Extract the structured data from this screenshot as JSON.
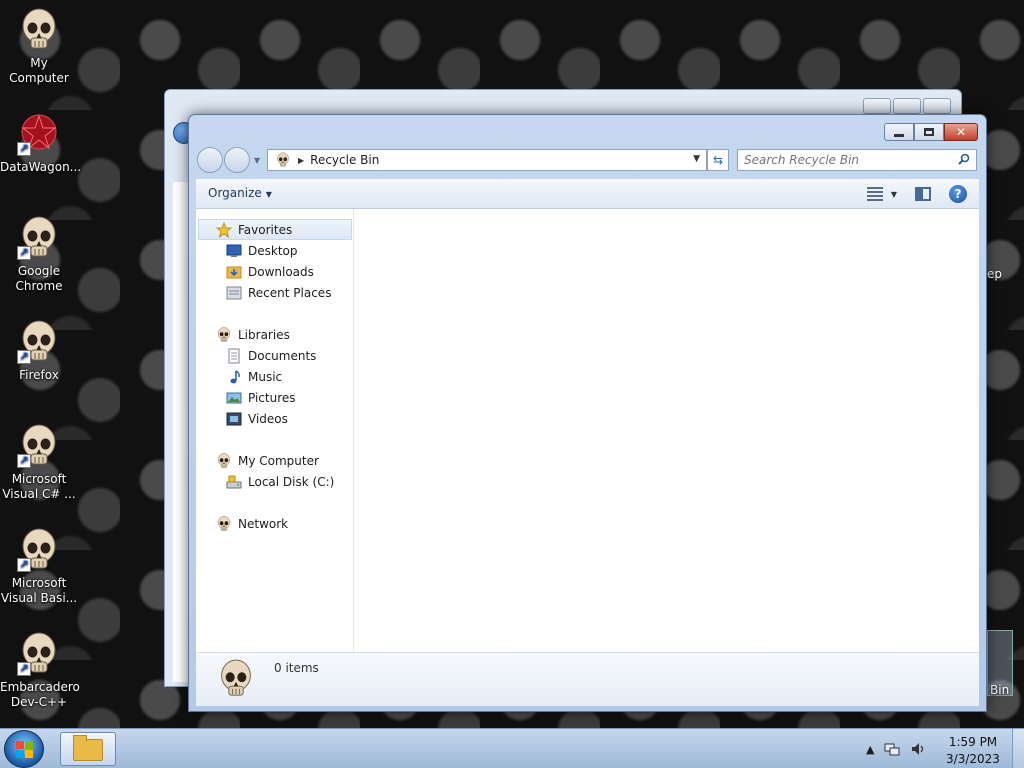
{
  "desktop": {
    "icons": [
      {
        "label": "My Computer",
        "shortcut": false
      },
      {
        "label": "DataWagon...",
        "shortcut": true
      },
      {
        "label": "Google Chrome",
        "shortcut": true
      },
      {
        "label": "Firefox",
        "shortcut": true
      },
      {
        "label": "Microsoft Visual C# ...",
        "shortcut": true
      },
      {
        "label": "Microsoft Visual Basi...",
        "shortcut": true
      },
      {
        "label": "Embarcadero Dev-C++",
        "shortcut": true
      }
    ],
    "edge_labels": {
      "right_top": "ep",
      "recycle_partial": "Bin"
    }
  },
  "window": {
    "address": {
      "location": "Recycle Bin"
    },
    "search": {
      "placeholder": "Search Recycle Bin"
    },
    "toolbar": {
      "organize_label": "Organize"
    },
    "nav_pane": {
      "favorites": {
        "label": "Favorites",
        "items": [
          "Desktop",
          "Downloads",
          "Recent Places"
        ]
      },
      "libraries": {
        "label": "Libraries",
        "items": [
          "Documents",
          "Music",
          "Pictures",
          "Videos"
        ]
      },
      "computer": {
        "label": "My Computer",
        "items": [
          "Local Disk (C:)"
        ]
      },
      "network": {
        "label": "Network"
      }
    },
    "details": {
      "item_count": "0 items"
    }
  },
  "taskbar": {
    "clock": {
      "time": "1:59 PM",
      "date": "3/3/2023"
    }
  },
  "colors": {
    "accent": "#1d5fb6",
    "window_frame": "#b3c9e6",
    "close_button": "#c0402a"
  }
}
